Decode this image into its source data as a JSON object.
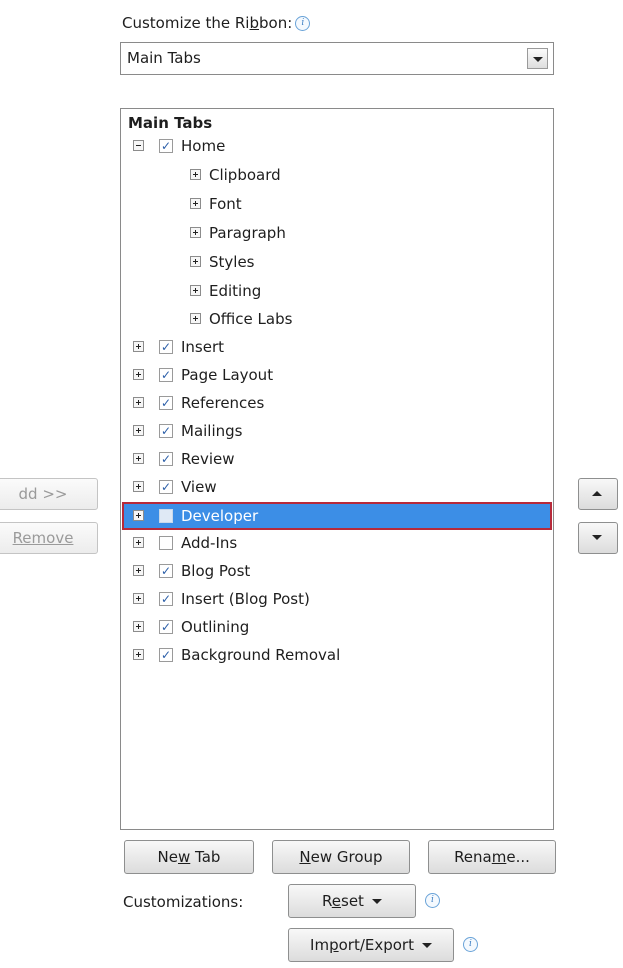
{
  "header": {
    "title_before": "Customize the Ri",
    "title_key": "b",
    "title_after": "bon:"
  },
  "dropdown": {
    "selected": "Main Tabs"
  },
  "tree": {
    "heading": "Main Tabs",
    "nodes": [
      {
        "label": "Home",
        "checked": true,
        "expanded": true
      },
      {
        "label": "Clipboard"
      },
      {
        "label": "Font"
      },
      {
        "label": "Paragraph"
      },
      {
        "label": "Styles"
      },
      {
        "label": "Editing"
      },
      {
        "label": "Office Labs"
      },
      {
        "label": "Insert",
        "checked": true
      },
      {
        "label": "Page Layout",
        "checked": true
      },
      {
        "label": "References",
        "checked": true
      },
      {
        "label": "Mailings",
        "checked": true
      },
      {
        "label": "Review",
        "checked": true
      },
      {
        "label": "View",
        "checked": true
      },
      {
        "label": "Developer",
        "checked": false,
        "selected": true
      },
      {
        "label": "Add-Ins",
        "checked": false
      },
      {
        "label": "Blog Post",
        "checked": true
      },
      {
        "label": "Insert (Blog Post)",
        "checked": true
      },
      {
        "label": "Outlining",
        "checked": true
      },
      {
        "label": "Background Removal",
        "checked": true
      }
    ]
  },
  "side_buttons": {
    "add": "dd >>",
    "remove": "Remove"
  },
  "bottom": {
    "new_tab_before": "Ne",
    "new_tab_key": "w",
    "new_tab_after": " Tab",
    "new_group_key": "N",
    "new_group_after": "ew Group",
    "rename_before": "Rena",
    "rename_key": "m",
    "rename_after": "e...",
    "customizations_label": "Customizations:",
    "reset_before": "R",
    "reset_key": "e",
    "reset_after": "set",
    "import_before": "Im",
    "import_key": "p",
    "import_after": "ort/Export"
  },
  "checkmark": "✓",
  "info_glyph": "i",
  "colors": {
    "selection": "#3c8ee6",
    "selection_border": "#b72a3a"
  }
}
